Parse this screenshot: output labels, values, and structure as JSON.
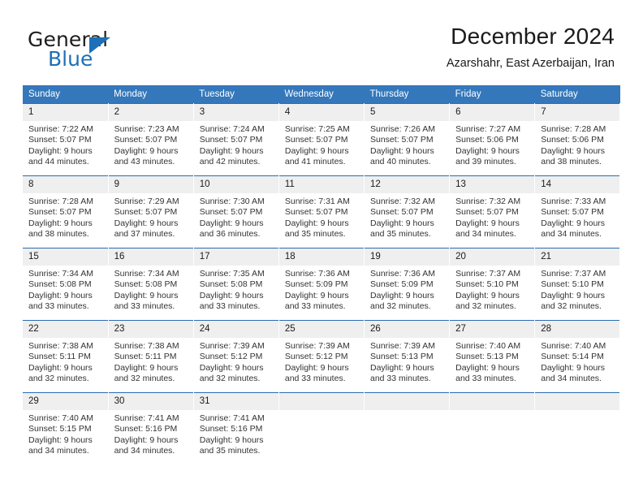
{
  "brand": {
    "name_part1": "General",
    "name_part2": "Blue",
    "logo_icon": "blue-triangle-icon"
  },
  "header": {
    "title": "December 2024",
    "subtitle": "Azarshahr, East Azerbaijan, Iran"
  },
  "colors": {
    "header_row_bg": "#3477bb",
    "cell_border": "#2b6cb0",
    "daynum_bg": "#efefef",
    "brand_blue": "#1d6fb8"
  },
  "calendar": {
    "weekday_headers": [
      "Sunday",
      "Monday",
      "Tuesday",
      "Wednesday",
      "Thursday",
      "Friday",
      "Saturday"
    ],
    "weeks": [
      [
        {
          "day": "1",
          "sunrise": "Sunrise: 7:22 AM",
          "sunset": "Sunset: 5:07 PM",
          "daylight1": "Daylight: 9 hours",
          "daylight2": "and 44 minutes."
        },
        {
          "day": "2",
          "sunrise": "Sunrise: 7:23 AM",
          "sunset": "Sunset: 5:07 PM",
          "daylight1": "Daylight: 9 hours",
          "daylight2": "and 43 minutes."
        },
        {
          "day": "3",
          "sunrise": "Sunrise: 7:24 AM",
          "sunset": "Sunset: 5:07 PM",
          "daylight1": "Daylight: 9 hours",
          "daylight2": "and 42 minutes."
        },
        {
          "day": "4",
          "sunrise": "Sunrise: 7:25 AM",
          "sunset": "Sunset: 5:07 PM",
          "daylight1": "Daylight: 9 hours",
          "daylight2": "and 41 minutes."
        },
        {
          "day": "5",
          "sunrise": "Sunrise: 7:26 AM",
          "sunset": "Sunset: 5:07 PM",
          "daylight1": "Daylight: 9 hours",
          "daylight2": "and 40 minutes."
        },
        {
          "day": "6",
          "sunrise": "Sunrise: 7:27 AM",
          "sunset": "Sunset: 5:06 PM",
          "daylight1": "Daylight: 9 hours",
          "daylight2": "and 39 minutes."
        },
        {
          "day": "7",
          "sunrise": "Sunrise: 7:28 AM",
          "sunset": "Sunset: 5:06 PM",
          "daylight1": "Daylight: 9 hours",
          "daylight2": "and 38 minutes."
        }
      ],
      [
        {
          "day": "8",
          "sunrise": "Sunrise: 7:28 AM",
          "sunset": "Sunset: 5:07 PM",
          "daylight1": "Daylight: 9 hours",
          "daylight2": "and 38 minutes."
        },
        {
          "day": "9",
          "sunrise": "Sunrise: 7:29 AM",
          "sunset": "Sunset: 5:07 PM",
          "daylight1": "Daylight: 9 hours",
          "daylight2": "and 37 minutes."
        },
        {
          "day": "10",
          "sunrise": "Sunrise: 7:30 AM",
          "sunset": "Sunset: 5:07 PM",
          "daylight1": "Daylight: 9 hours",
          "daylight2": "and 36 minutes."
        },
        {
          "day": "11",
          "sunrise": "Sunrise: 7:31 AM",
          "sunset": "Sunset: 5:07 PM",
          "daylight1": "Daylight: 9 hours",
          "daylight2": "and 35 minutes."
        },
        {
          "day": "12",
          "sunrise": "Sunrise: 7:32 AM",
          "sunset": "Sunset: 5:07 PM",
          "daylight1": "Daylight: 9 hours",
          "daylight2": "and 35 minutes."
        },
        {
          "day": "13",
          "sunrise": "Sunrise: 7:32 AM",
          "sunset": "Sunset: 5:07 PM",
          "daylight1": "Daylight: 9 hours",
          "daylight2": "and 34 minutes."
        },
        {
          "day": "14",
          "sunrise": "Sunrise: 7:33 AM",
          "sunset": "Sunset: 5:07 PM",
          "daylight1": "Daylight: 9 hours",
          "daylight2": "and 34 minutes."
        }
      ],
      [
        {
          "day": "15",
          "sunrise": "Sunrise: 7:34 AM",
          "sunset": "Sunset: 5:08 PM",
          "daylight1": "Daylight: 9 hours",
          "daylight2": "and 33 minutes."
        },
        {
          "day": "16",
          "sunrise": "Sunrise: 7:34 AM",
          "sunset": "Sunset: 5:08 PM",
          "daylight1": "Daylight: 9 hours",
          "daylight2": "and 33 minutes."
        },
        {
          "day": "17",
          "sunrise": "Sunrise: 7:35 AM",
          "sunset": "Sunset: 5:08 PM",
          "daylight1": "Daylight: 9 hours",
          "daylight2": "and 33 minutes."
        },
        {
          "day": "18",
          "sunrise": "Sunrise: 7:36 AM",
          "sunset": "Sunset: 5:09 PM",
          "daylight1": "Daylight: 9 hours",
          "daylight2": "and 33 minutes."
        },
        {
          "day": "19",
          "sunrise": "Sunrise: 7:36 AM",
          "sunset": "Sunset: 5:09 PM",
          "daylight1": "Daylight: 9 hours",
          "daylight2": "and 32 minutes."
        },
        {
          "day": "20",
          "sunrise": "Sunrise: 7:37 AM",
          "sunset": "Sunset: 5:10 PM",
          "daylight1": "Daylight: 9 hours",
          "daylight2": "and 32 minutes."
        },
        {
          "day": "21",
          "sunrise": "Sunrise: 7:37 AM",
          "sunset": "Sunset: 5:10 PM",
          "daylight1": "Daylight: 9 hours",
          "daylight2": "and 32 minutes."
        }
      ],
      [
        {
          "day": "22",
          "sunrise": "Sunrise: 7:38 AM",
          "sunset": "Sunset: 5:11 PM",
          "daylight1": "Daylight: 9 hours",
          "daylight2": "and 32 minutes."
        },
        {
          "day": "23",
          "sunrise": "Sunrise: 7:38 AM",
          "sunset": "Sunset: 5:11 PM",
          "daylight1": "Daylight: 9 hours",
          "daylight2": "and 32 minutes."
        },
        {
          "day": "24",
          "sunrise": "Sunrise: 7:39 AM",
          "sunset": "Sunset: 5:12 PM",
          "daylight1": "Daylight: 9 hours",
          "daylight2": "and 32 minutes."
        },
        {
          "day": "25",
          "sunrise": "Sunrise: 7:39 AM",
          "sunset": "Sunset: 5:12 PM",
          "daylight1": "Daylight: 9 hours",
          "daylight2": "and 33 minutes."
        },
        {
          "day": "26",
          "sunrise": "Sunrise: 7:39 AM",
          "sunset": "Sunset: 5:13 PM",
          "daylight1": "Daylight: 9 hours",
          "daylight2": "and 33 minutes."
        },
        {
          "day": "27",
          "sunrise": "Sunrise: 7:40 AM",
          "sunset": "Sunset: 5:13 PM",
          "daylight1": "Daylight: 9 hours",
          "daylight2": "and 33 minutes."
        },
        {
          "day": "28",
          "sunrise": "Sunrise: 7:40 AM",
          "sunset": "Sunset: 5:14 PM",
          "daylight1": "Daylight: 9 hours",
          "daylight2": "and 34 minutes."
        }
      ],
      [
        {
          "day": "29",
          "sunrise": "Sunrise: 7:40 AM",
          "sunset": "Sunset: 5:15 PM",
          "daylight1": "Daylight: 9 hours",
          "daylight2": "and 34 minutes."
        },
        {
          "day": "30",
          "sunrise": "Sunrise: 7:41 AM",
          "sunset": "Sunset: 5:16 PM",
          "daylight1": "Daylight: 9 hours",
          "daylight2": "and 34 minutes."
        },
        {
          "day": "31",
          "sunrise": "Sunrise: 7:41 AM",
          "sunset": "Sunset: 5:16 PM",
          "daylight1": "Daylight: 9 hours",
          "daylight2": "and 35 minutes."
        },
        {
          "day": "",
          "sunrise": "",
          "sunset": "",
          "daylight1": "",
          "daylight2": ""
        },
        {
          "day": "",
          "sunrise": "",
          "sunset": "",
          "daylight1": "",
          "daylight2": ""
        },
        {
          "day": "",
          "sunrise": "",
          "sunset": "",
          "daylight1": "",
          "daylight2": ""
        },
        {
          "day": "",
          "sunrise": "",
          "sunset": "",
          "daylight1": "",
          "daylight2": ""
        }
      ]
    ]
  }
}
